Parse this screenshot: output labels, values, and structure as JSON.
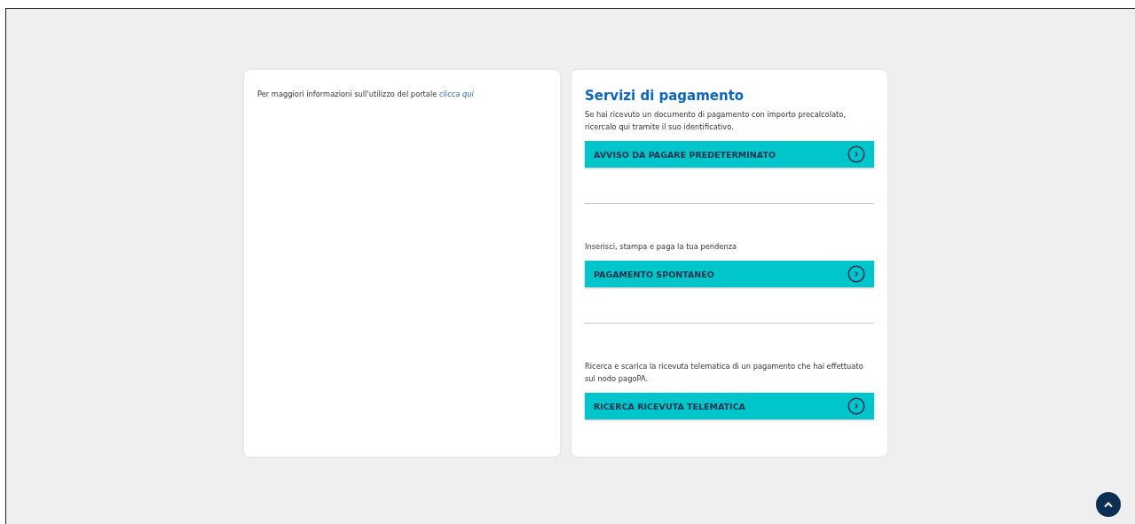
{
  "info": {
    "text": "Per maggiori informazioni sull'utilizzo del portale",
    "link": "clicca qui"
  },
  "services": {
    "title": "Servizi di pagamento",
    "sections": [
      {
        "description": "Se hai ricevuto un documento di pagamento con importo precalcolato, ricercalo qui tramite il suo identificativo.",
        "button": "AVVISO DA PAGARE PREDETERMINATO"
      },
      {
        "description": "Inserisci, stampa e paga la tua pendenza",
        "button": "PAGAMENTO SPONTANEO"
      },
      {
        "description": "Ricerca e scarica la ricevuta telematica di un pagamento che hai effettuato sul nodo pagoPA.",
        "button": "RICERCA RICEVUTA TELEMATICA"
      }
    ]
  }
}
